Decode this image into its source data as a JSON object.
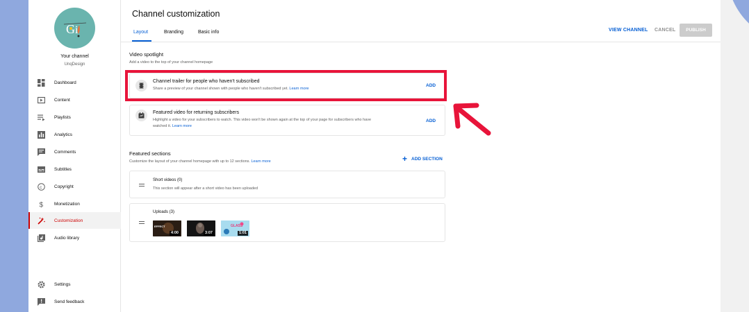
{
  "sidebar": {
    "channel_name": "Your channel",
    "channel_handle": "UnqDesign",
    "items": [
      {
        "label": "Dashboard",
        "icon": "dashboard-icon"
      },
      {
        "label": "Content",
        "icon": "content-icon"
      },
      {
        "label": "Playlists",
        "icon": "playlists-icon"
      },
      {
        "label": "Analytics",
        "icon": "analytics-icon"
      },
      {
        "label": "Comments",
        "icon": "comments-icon"
      },
      {
        "label": "Subtitles",
        "icon": "subtitles-icon"
      },
      {
        "label": "Copyright",
        "icon": "copyright-icon"
      },
      {
        "label": "Monetization",
        "icon": "monetization-icon"
      },
      {
        "label": "Customization",
        "icon": "customization-icon",
        "active": true
      },
      {
        "label": "Audio library",
        "icon": "audio-library-icon"
      }
    ],
    "bottom_items": [
      {
        "label": "Settings",
        "icon": "settings-icon"
      },
      {
        "label": "Send feedback",
        "icon": "feedback-icon"
      }
    ]
  },
  "header": {
    "title": "Channel customization",
    "tabs": [
      {
        "label": "Layout",
        "active": true
      },
      {
        "label": "Branding"
      },
      {
        "label": "Basic info"
      }
    ],
    "view_channel_label": "VIEW CHANNEL",
    "cancel_label": "CANCEL",
    "publish_label": "PUBLISH"
  },
  "video_spotlight": {
    "title": "Video spotlight",
    "subtitle": "Add a video to the top of your channel homepage",
    "trailer": {
      "title": "Channel trailer for people who haven't subscribed",
      "description": "Share a preview of your channel shown with people who haven't subscribed yet.",
      "learn_more": "Learn more",
      "add_label": "ADD"
    },
    "featured": {
      "title": "Featured video for returning subscribers",
      "description_line1": "Highlight a video for your subscribers to watch. This video won't be shown again at the top of your page for subscribers who have",
      "description_line2": "watched it.",
      "learn_more": "Learn more",
      "add_label": "ADD"
    }
  },
  "featured_sections": {
    "title": "Featured sections",
    "subtitle": "Customize the layout of your channel homepage with up to 12 sections.",
    "learn_more": "Learn more",
    "add_section_label": "ADD SECTION",
    "short_videos": {
      "title": "Short videos (0)",
      "description": "This section will appear after a short video has been uploaded"
    },
    "uploads": {
      "title": "Uploads (3)",
      "videos": [
        {
          "duration": "4:00",
          "thumb_text": "EFFECT"
        },
        {
          "duration": "3:07"
        },
        {
          "duration": "1:01",
          "thumb_text": "GLASS"
        }
      ]
    }
  },
  "colors": {
    "accent": "#065fd4",
    "active_red": "#cc0000",
    "highlight": "#e8143a",
    "background": "#8fa8de"
  }
}
